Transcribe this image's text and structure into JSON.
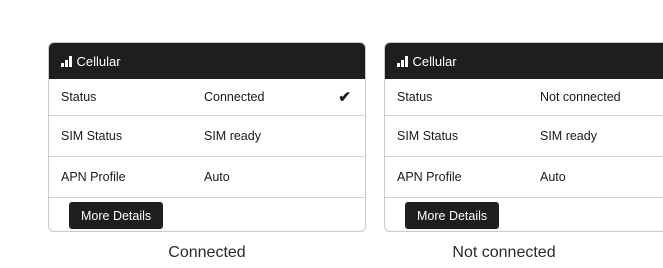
{
  "cards": [
    {
      "header": {
        "title": "Cellular",
        "icon": "signal-bars-icon"
      },
      "rows": [
        {
          "label": "Status",
          "value": "Connected",
          "check": "✔"
        },
        {
          "label": "SIM Status",
          "value": "SIM ready"
        },
        {
          "label": "APN Profile",
          "value": "Auto"
        }
      ],
      "button_label": "More Details",
      "caption": "Connected"
    },
    {
      "header": {
        "title": "Cellular",
        "icon": "signal-bars-icon"
      },
      "rows": [
        {
          "label": "Status",
          "value": "Not connected"
        },
        {
          "label": "SIM Status",
          "value": "SIM ready"
        },
        {
          "label": "APN Profile",
          "value": "Auto"
        }
      ],
      "button_label": "More Details",
      "caption": "Not connected"
    }
  ],
  "colors": {
    "header_bg": "#1f1d1e",
    "button_bg": "#1f1d1e",
    "border": "#c9c9c9"
  }
}
